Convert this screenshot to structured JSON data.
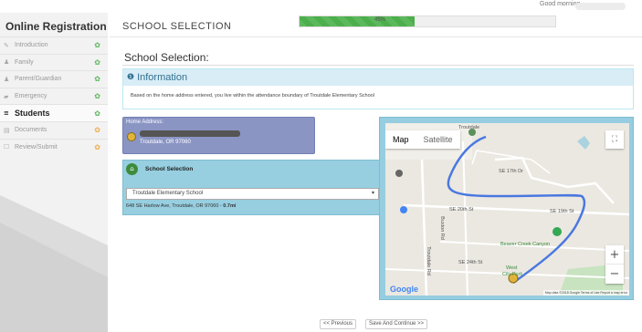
{
  "header": {
    "greeting": "Good morning,",
    "section_title": "SCHOOL SELECTION",
    "progress_percent": 45,
    "progress_label": "45%"
  },
  "sidebar": {
    "title": "Online Registration",
    "items": [
      {
        "label": "Introduction",
        "icon": "pencil-icon",
        "glyph": "✎",
        "status": "✿",
        "status_color": "#5cb85c",
        "active": false
      },
      {
        "label": "Family",
        "icon": "family-icon",
        "glyph": "♟",
        "status": "✿",
        "status_color": "#5cb85c",
        "active": false
      },
      {
        "label": "Parent/Guardian",
        "icon": "user-icon",
        "glyph": "♟",
        "status": "✿",
        "status_color": "#5cb85c",
        "active": false
      },
      {
        "label": "Emergency",
        "icon": "ambulance-icon",
        "glyph": "▰",
        "status": "✿",
        "status_color": "#5cb85c",
        "active": false
      },
      {
        "label": "Students",
        "icon": "graduation-cap-icon",
        "glyph": "≡",
        "status": "✿",
        "status_color": "#5cb85c",
        "active": true
      },
      {
        "label": "Documents",
        "icon": "document-icon",
        "glyph": "▤",
        "status": "✿",
        "status_color": "#f0ad4e",
        "active": false
      },
      {
        "label": "Review/Submit",
        "icon": "checkbox-icon",
        "glyph": "☐",
        "status": "✿",
        "status_color": "#f0ad4e",
        "active": false
      }
    ]
  },
  "main": {
    "page_heading": "School Selection:",
    "info": {
      "icon": "info-icon",
      "title": "Information",
      "text": "Based on the home address entered, you live within the attendance boundary of Troutdale Elementary School"
    },
    "home_address": {
      "label": "Home Address:",
      "city": "Troutdale, OR 97060"
    },
    "school_selection": {
      "title": "School Selection",
      "selected": "Troutdale Elementary School",
      "address": "648 SE Harlow Ave, Troutdale, OR 97060 - ",
      "distance": "0.7mi"
    },
    "map": {
      "tab_map": "Map",
      "tab_satellite": "Satellite",
      "zoom_in": "+",
      "zoom_out": "−",
      "attribution": "Map data ©2018 Google   Terms of Use   Report a map error",
      "logo": "Google",
      "labels": {
        "troutdale": "Troutdale",
        "beaver_creek": "Beaver Creek Canyon",
        "west": "West",
        "city_park": "City Park",
        "buxton": "Buxton Rd",
        "troutdale_rd": "Troutdale Rd",
        "se_17th": "SE 17th Dr",
        "se_20th": "SE 20th St",
        "se_24th": "SE 24th St",
        "se_19th": "SE 19th St"
      }
    }
  },
  "footer": {
    "previous_label": "<< Previous",
    "save_label": "Save And Continue >>"
  },
  "colors": {
    "accent": "#5cb85c",
    "info_bg": "#d9edf7",
    "address_bg": "#8b95c4",
    "school_bg": "#97cfe0"
  }
}
